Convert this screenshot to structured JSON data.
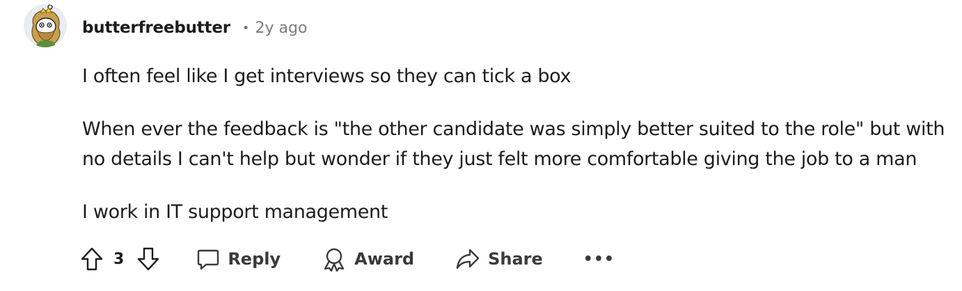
{
  "comment": {
    "author": "butterfreebutter",
    "separator": "•",
    "time_ago": "2y ago",
    "avatar_icon": "snoo-avatar-icon",
    "paragraphs": [
      "I often feel like I get interviews so they can tick a box",
      "When ever the feedback is \"the other candidate was simply better suited to the role\" but with no details I can't help but wonder if they just felt more comfortable giving the job to a man",
      "I work in IT support management"
    ]
  },
  "actions": {
    "upvote_icon": "arrow-up-icon",
    "vote_count": "3",
    "downvote_icon": "arrow-down-icon",
    "reply_label": "Reply",
    "reply_icon": "speech-bubble-icon",
    "award_label": "Award",
    "award_icon": "award-ribbon-icon",
    "share_label": "Share",
    "share_icon": "share-arrow-icon",
    "more_label": "•••"
  },
  "colors": {
    "text": "#1c1c1c",
    "meta": "#7c7c7c",
    "action": "#3a3a3a",
    "background": "#ffffff"
  }
}
